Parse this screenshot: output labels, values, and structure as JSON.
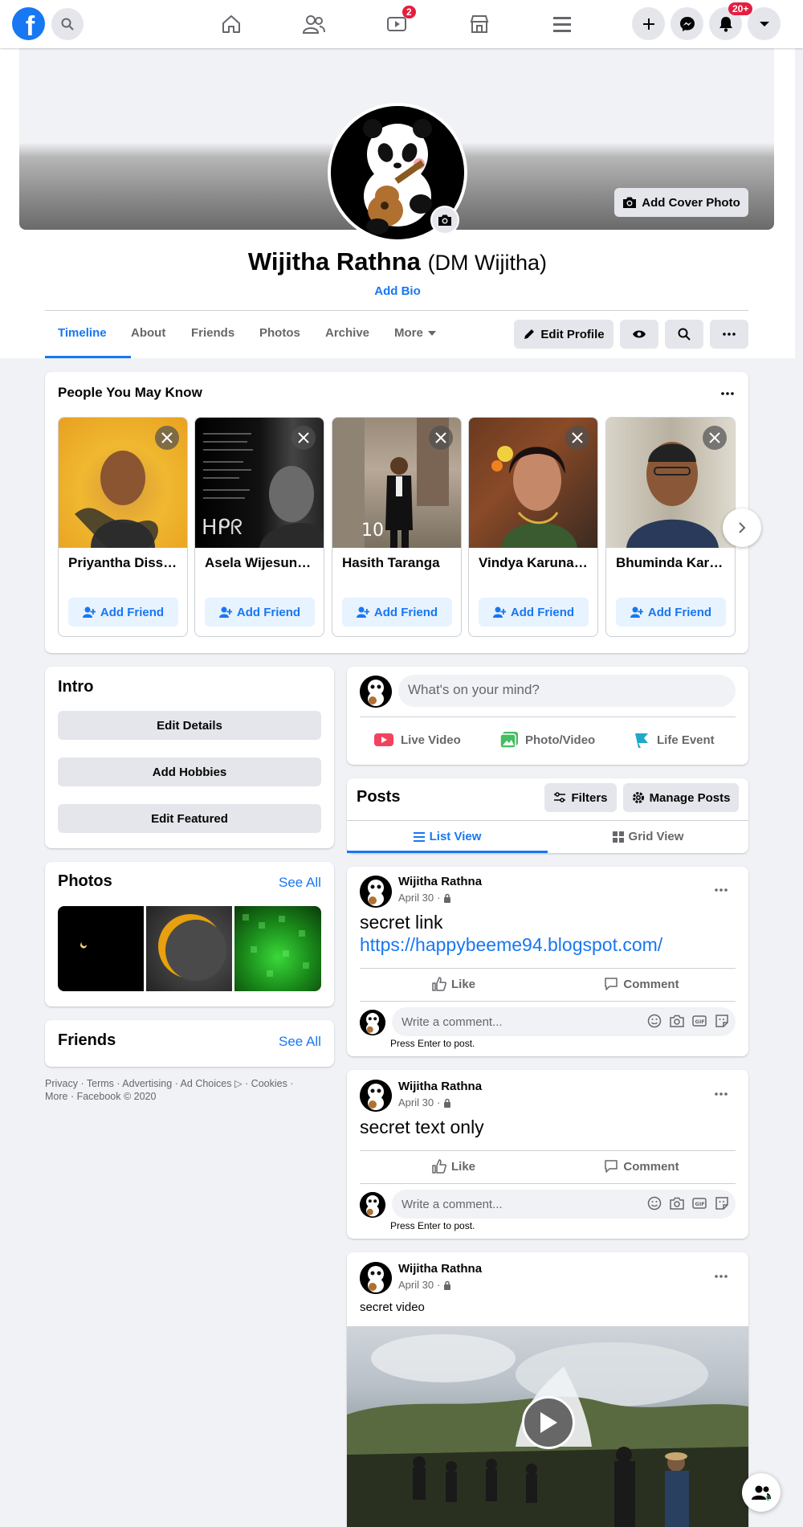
{
  "topbar": {
    "video_badge": "2",
    "notifications_badge": "20+"
  },
  "profile": {
    "name": "Wijitha Rathna",
    "alt_name": "(DM Wijitha)",
    "add_bio": "Add Bio",
    "add_cover_photo": "Add Cover Photo"
  },
  "tabs": [
    {
      "label": "Timeline",
      "active": true
    },
    {
      "label": "About"
    },
    {
      "label": "Friends"
    },
    {
      "label": "Photos"
    },
    {
      "label": "Archive"
    },
    {
      "label": "More"
    }
  ],
  "profile_actions": {
    "edit_profile": "Edit Profile"
  },
  "pymk": {
    "title": "People You May Know",
    "add_friend_label": "Add Friend",
    "people": [
      {
        "name": "Priyantha Dissanayake"
      },
      {
        "name": "Asela Wijesundara"
      },
      {
        "name": "Hasith Taranga"
      },
      {
        "name": "Vindya Karunaratne"
      },
      {
        "name": "Bhuminda Karunaratne"
      }
    ]
  },
  "intro": {
    "title": "Intro",
    "buttons": [
      "Edit Details",
      "Add Hobbies",
      "Edit Featured"
    ]
  },
  "photos": {
    "title": "Photos",
    "see_all": "See All"
  },
  "friends": {
    "title": "Friends",
    "see_all": "See All"
  },
  "footer": {
    "line1": "Privacy · Terms · Advertising · Ad Choices ▷ · Cookies ·",
    "line2": "More · Facebook © 2020"
  },
  "composer": {
    "placeholder": "What's on your mind?",
    "live_video": "Live Video",
    "photo_video": "Photo/Video",
    "life_event": "Life Event"
  },
  "posts_header": {
    "title": "Posts",
    "filters": "Filters",
    "manage_posts": "Manage Posts",
    "list_view": "List View",
    "grid_view": "Grid View"
  },
  "post_common": {
    "like": "Like",
    "comment": "Comment",
    "write_comment": "Write a comment...",
    "press_enter": "Press Enter to post."
  },
  "posts": [
    {
      "author": "Wijitha Rathna",
      "date": "April 30",
      "text": "secret link",
      "link": "https://happybeeme94.blogspot.com/"
    },
    {
      "author": "Wijitha Rathna",
      "date": "April 30",
      "text": "secret text only"
    },
    {
      "author": "Wijitha Rathna",
      "date": "April 30",
      "text": "secret video"
    }
  ],
  "chat_badge": "0",
  "colors": {
    "brand": "#1877f2",
    "badge": "#e41e3f",
    "background": "#f0f2f5"
  }
}
